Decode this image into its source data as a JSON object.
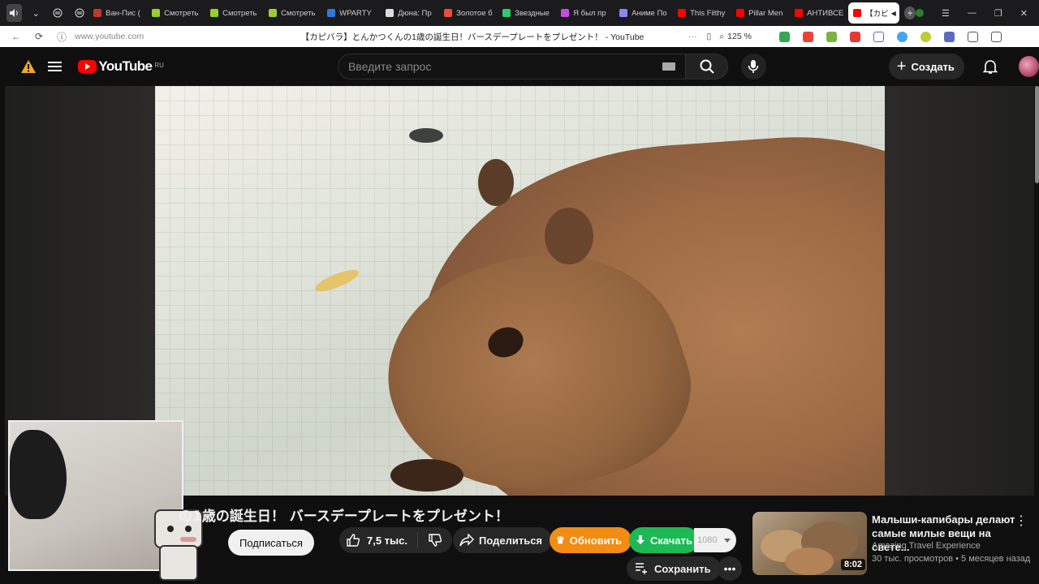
{
  "browser": {
    "tabs": [
      {
        "label": "Ван-Пис (",
        "color": "#c0392b"
      },
      {
        "label": "Смотреть",
        "color": "#9acd32"
      },
      {
        "label": "Смотреть",
        "color": "#9acd32"
      },
      {
        "label": "Смотреть",
        "color": "#9acd32"
      },
      {
        "label": "WPARTY",
        "color": "#2b7bd6"
      },
      {
        "label": "Дюна: Пр",
        "color": "#dddddd"
      },
      {
        "label": "Золотое б",
        "color": "#e74c3c"
      },
      {
        "label": "Звездные",
        "color": "#2ecc71"
      },
      {
        "label": "Я был пр",
        "color": "#c04fe0"
      },
      {
        "label": "Аниме По",
        "color": "#8888ff"
      },
      {
        "label": "This Filthy",
        "color": "#ff0000"
      },
      {
        "label": "Pillar Men",
        "color": "#ff0000"
      },
      {
        "label": "АНТИВСЕ",
        "color": "#ff0000"
      }
    ],
    "current_tab": {
      "label": "【カビ",
      "color": "#ff0000"
    },
    "url": "www.youtube.com",
    "page_title": "【カピバラ】とんかつくんの1歳の誕生日！バースデープレートをプレゼント！ - YouTube",
    "zoom": "125 %"
  },
  "masthead": {
    "logo_text": "YouTube",
    "country_code": "RU",
    "search_placeholder": "Введите запрос",
    "create_label": "Создать"
  },
  "video": {
    "title": "の1歳の誕生日！ バースデープレートをプレゼント！"
  },
  "actions": {
    "subscribe_label": "Подписаться",
    "like_count": "7,5 тыс.",
    "share_label": "Поделиться",
    "upgrade_label": "Обновить",
    "download_label": "Скачать",
    "resolution": "1080",
    "save_label": "Сохранить",
    "more_label": "•••"
  },
  "recommendation": {
    "title": "Малыши-капибары делают самые милые вещи на свете...",
    "channel": "Amazing Travel Experience",
    "meta": "30 тыс. просмотров • 5 месяцев назад",
    "duration": "8:02"
  },
  "colors": {
    "youtube_red": "#ff0000",
    "upgrade_orange": "#f28c13",
    "download_green": "#1db954"
  }
}
